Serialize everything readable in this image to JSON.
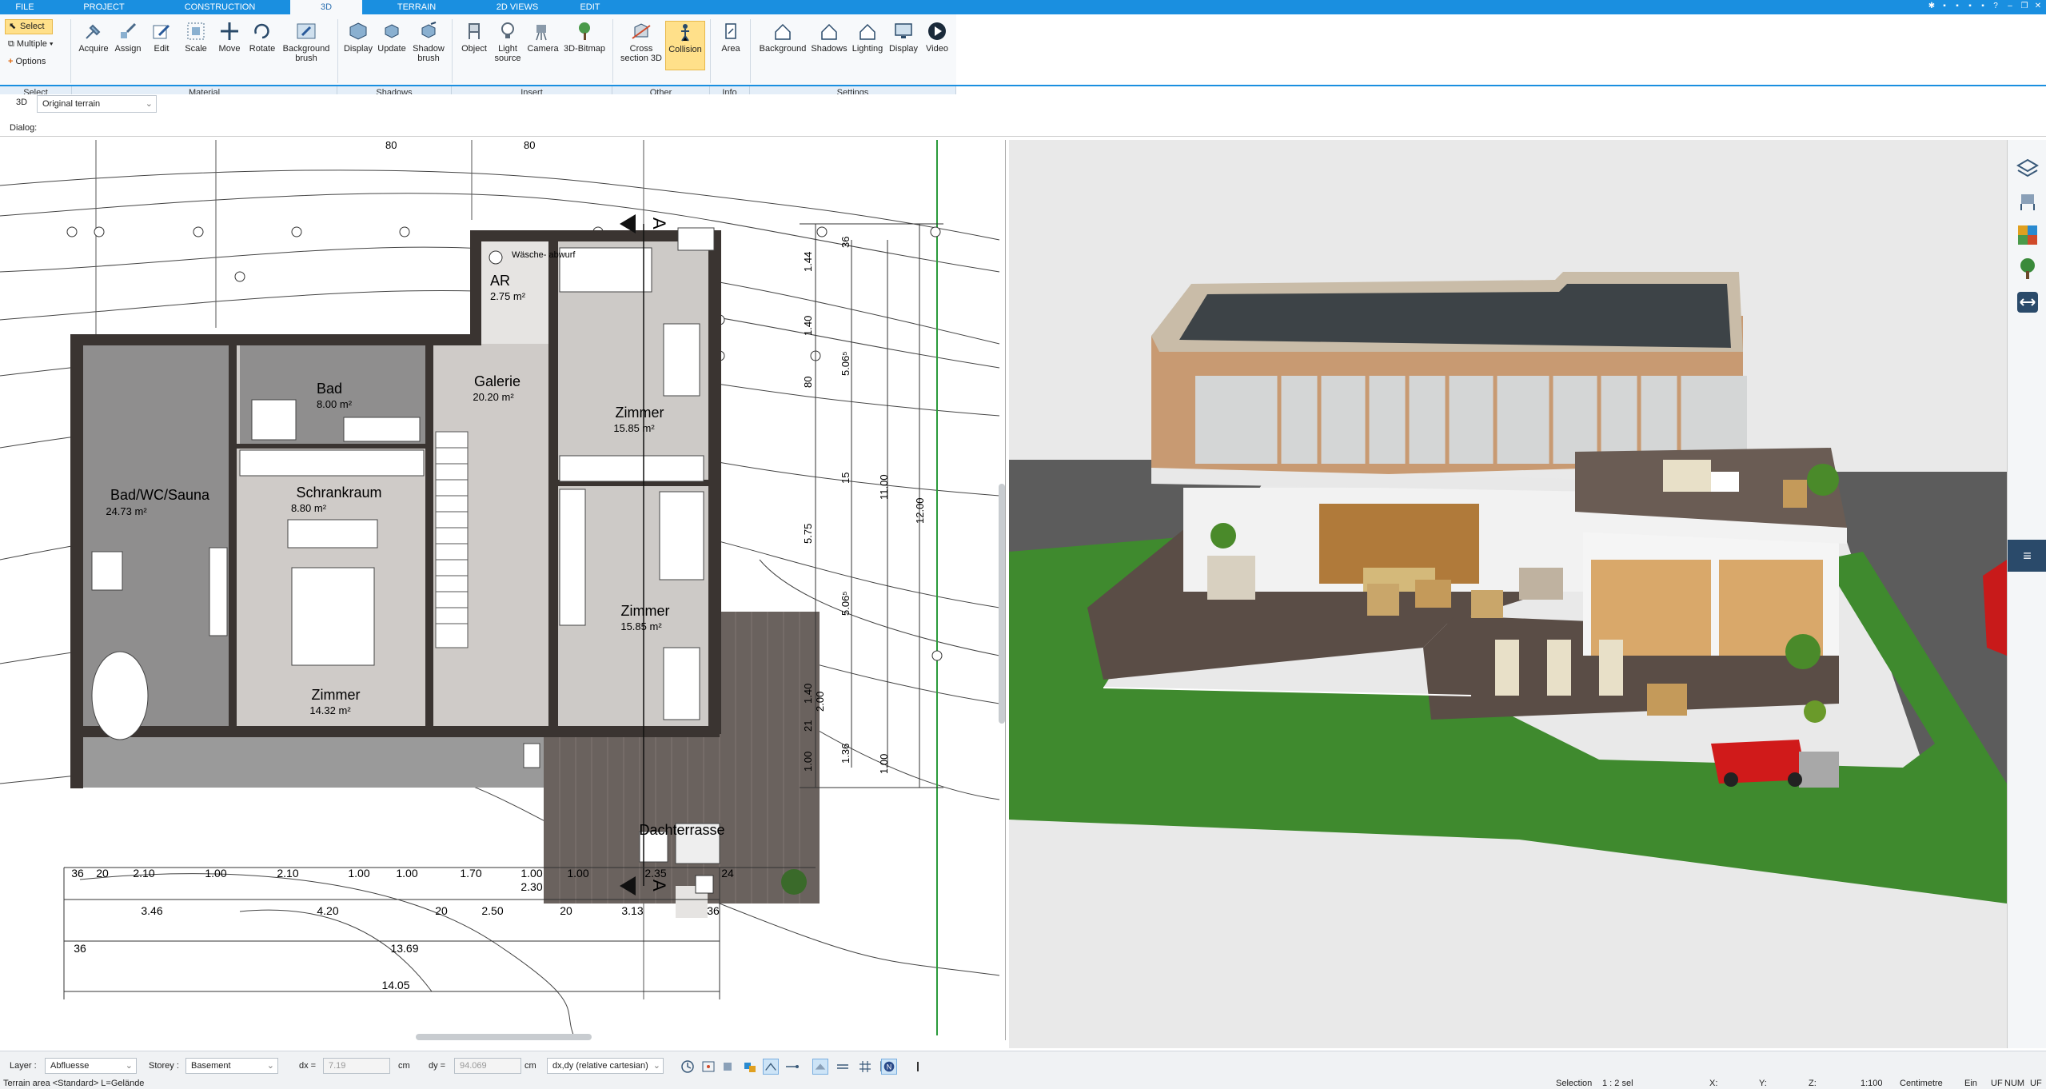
{
  "tabs": [
    "FILE",
    "PROJECT",
    "CONSTRUCTION",
    "3D",
    "TERRAIN",
    "2D VIEWS",
    "EDIT"
  ],
  "active_tab": "3D",
  "ribbon": {
    "select_group": {
      "select": "Select",
      "multiple": "Multiple",
      "options": "Options",
      "group": "Select"
    },
    "material": {
      "acquire": "Acquire",
      "assign": "Assign",
      "edit": "Edit",
      "scale": "Scale",
      "move": "Move",
      "rotate": "Rotate",
      "bg_brush": "Background\nbrush",
      "group": "Material"
    },
    "shadows": {
      "display": "Display",
      "update": "Update",
      "shadow_brush": "Shadow\nbrush",
      "group": "Shadows"
    },
    "insert": {
      "object": "Object",
      "light": "Light\nsource",
      "camera": "Camera",
      "bitmap": "3D-Bitmap",
      "group": "Insert"
    },
    "other": {
      "cross": "Cross\nsection 3D",
      "collision": "Collision",
      "group": "Other"
    },
    "info": {
      "area": "Area",
      "group": "Info"
    },
    "settings": {
      "background": "Background",
      "shadows": "Shadows",
      "lighting": "Lighting",
      "display": "Display",
      "video": "Video",
      "group": "Settings"
    }
  },
  "subbar": {
    "mode": "3D",
    "terrain": "Original terrain"
  },
  "dialog_label": "Dialog:",
  "plan": {
    "rooms": [
      {
        "name": "Bad",
        "area": "8.00 m²"
      },
      {
        "name": "Galerie",
        "area": "20.20 m²"
      },
      {
        "name": "Zimmer",
        "area": "15.85 m²"
      },
      {
        "name": "AR",
        "area": "2.75 m²"
      },
      {
        "name": "Bad/WC/Sauna",
        "area": "24.73 m²"
      },
      {
        "name": "Schrankraum",
        "area": "8.80 m²"
      },
      {
        "name": "Zimmer",
        "area": "15.85 m²"
      },
      {
        "name": "Zimmer",
        "area": "14.32 m²"
      },
      {
        "name": "Dachterrasse",
        "area": ""
      }
    ],
    "waesche": "Wäsche-\nabwurf",
    "section_mark": "A",
    "top_dims": [
      "80",
      "80"
    ],
    "right_dims": [
      "36",
      "1.44",
      "1.40",
      "80",
      "5.06⁵",
      "15",
      "5.75",
      "5.06⁵",
      "1.40",
      "21",
      "1.36",
      "1.00",
      "2.00",
      "11.00",
      "12.00",
      "1.00"
    ],
    "bottom_row1": [
      "36",
      "20",
      "2.10",
      "1.00",
      "2.10",
      "1.00",
      "1.00",
      "1.70",
      "1.00",
      "1.00",
      "2.35",
      "24"
    ],
    "bottom_row1b": "2.30",
    "bottom_row2": [
      "3.46",
      "4.20",
      "20",
      "2.50",
      "20",
      "3.13",
      "36"
    ],
    "bottom_row3": [
      "36",
      "13.69"
    ],
    "bottom_row4": "14.05"
  },
  "status": {
    "layer_label": "Layer :",
    "layer": "Abfluesse",
    "storey_label": "Storey :",
    "storey": "Basement",
    "dx_label": "dx =",
    "dx": "7.19",
    "dy_label": "dy =",
    "dy": "94.069",
    "unit": "cm",
    "coord_mode": "dx,dy (relative cartesian)"
  },
  "bottom": {
    "left": "Terrain area <Standard> L=Gelände",
    "selection": "Selection",
    "sel_val": "1 : 2 sel",
    "x": "X:",
    "y": "Y:",
    "z": "Z:",
    "scale": "1:100",
    "units": "Centimetre",
    "ein": "Ein",
    "uf": "UF",
    "num": "NUM",
    "uf2": "UF"
  },
  "colors": {
    "accent": "#1a8fe0",
    "select": "#ffe08a",
    "wall": "#3a3431",
    "grass": "#3f8a2e",
    "deck": "#5a4d46"
  }
}
